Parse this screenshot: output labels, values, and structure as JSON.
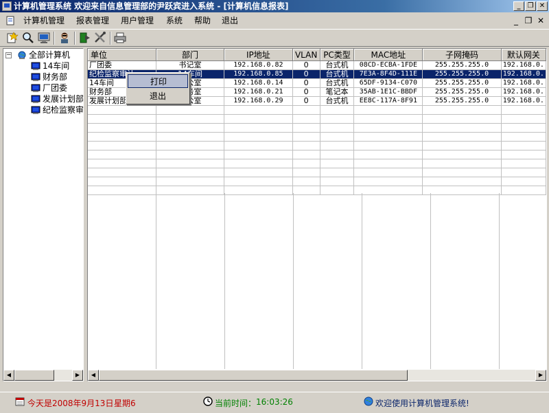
{
  "window": {
    "title": "计算机管理系统    欢迎来自信息管理部的尹跃宾进入系统 - [计算机信息报表]",
    "minimize_glyph": "_",
    "restore_glyph": "❐",
    "close_glyph": "✕"
  },
  "menu": {
    "items": [
      "计算机管理",
      "报表管理",
      "用户管理",
      "系统",
      "帮助",
      "退出"
    ],
    "mdi_min": "_",
    "mdi_restore": "❐",
    "mdi_close": "✕"
  },
  "toolbar": {
    "icons": [
      "new-icon",
      "search-icon",
      "monitor-icon",
      "user-icon",
      "export-icon",
      "tools-icon",
      "printer-icon"
    ]
  },
  "tree": {
    "root": "全部计算机",
    "root_expander": "−",
    "children": [
      "14车间",
      "财务部",
      "厂团委",
      "发展计划部",
      "纪检监察审计"
    ]
  },
  "grid": {
    "columns": [
      "单位",
      "部门",
      "IP地址",
      "VLAN",
      "PC类型",
      "MAC地址",
      "子网掩码",
      "默认网关"
    ],
    "rows": [
      [
        "厂团委",
        "书记室",
        "192.168.0.82",
        "0",
        "台式机",
        "08CD-ECBA-1FDE",
        "255.255.255.0",
        "192.168.0."
      ],
      [
        "纪检监察审计",
        "14车间",
        "192.168.0.85",
        "0",
        "台式机",
        "7E3A-8F4D-111E",
        "255.255.255.0",
        "192.168.0."
      ],
      [
        "14车间",
        "办公室",
        "192.168.0.14",
        "0",
        "台式机",
        "65DF-9134-C070",
        "255.255.255.0",
        "192.168.0."
      ],
      [
        "财务部",
        "财务室",
        "192.168.0.21",
        "0",
        "笔记本",
        "35AB-1E1C-BBDF",
        "255.255.255.0",
        "192.168.0."
      ],
      [
        "发展计划部",
        "办公室",
        "192.168.0.29",
        "0",
        "台式机",
        "EE8C-117A-8F91",
        "255.255.255.0",
        "192.168.0."
      ]
    ],
    "selected_row": 1
  },
  "context_menu": {
    "items": [
      "打印",
      "退出"
    ]
  },
  "status": {
    "date": "今天是2008年9月13日",
    "weekday": "星期6",
    "time_label": "当前时间：",
    "time": "16:03:26",
    "welcome": "欢迎使用计算机管理系统!"
  },
  "colors": {
    "title_gradient_start": "#0a246a",
    "selection": "#0a246a",
    "date_text": "#c00000",
    "time_text": "#008000",
    "welcome_text": "#0a246a"
  }
}
